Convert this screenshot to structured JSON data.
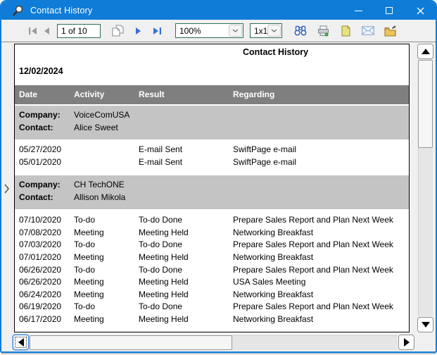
{
  "window": {
    "title": "Contact History"
  },
  "toolbar": {
    "page_value": "1 of 10",
    "zoom_value": "100%",
    "grid_value": "1x1",
    "icons": [
      "first-page",
      "previous-page",
      "copy-pages",
      "next-page",
      "last-page",
      "search-binoculars",
      "print",
      "page-setup",
      "email",
      "export-folder"
    ]
  },
  "report": {
    "title": "Contact History",
    "date": "12/02/2024",
    "columns": [
      "Date",
      "Activity",
      "Result",
      "Regarding"
    ],
    "groups": [
      {
        "company_label": "Company:",
        "company": "VoiceComUSA",
        "contact_label": "Contact:",
        "contact": "Alice Sweet",
        "rows": [
          {
            "date": "05/27/2020",
            "activity": "",
            "result": "E-mail Sent",
            "regarding": "SwiftPage e-mail"
          },
          {
            "date": "05/01/2020",
            "activity": "",
            "result": "E-mail Sent",
            "regarding": "SwiftPage e-mail"
          }
        ]
      },
      {
        "company_label": "Company:",
        "company": "CH TechONE",
        "contact_label": "Contact:",
        "contact": "Allison Mikola",
        "rows": [
          {
            "date": "07/10/2020",
            "activity": "To-do",
            "result": "To-do Done",
            "regarding": "Prepare Sales Report and Plan Next Week"
          },
          {
            "date": "07/08/2020",
            "activity": "Meeting",
            "result": "Meeting Held",
            "regarding": "Networking Breakfast"
          },
          {
            "date": "07/03/2020",
            "activity": "To-do",
            "result": "To-do Done",
            "regarding": "Prepare Sales Report and Plan Next Week"
          },
          {
            "date": "07/01/2020",
            "activity": "Meeting",
            "result": "Meeting Held",
            "regarding": "Networking Breakfast"
          },
          {
            "date": "06/26/2020",
            "activity": "To-do",
            "result": "To-do Done",
            "regarding": "Prepare Sales Report and Plan Next Week"
          },
          {
            "date": "06/26/2020",
            "activity": "Meeting",
            "result": "Meeting Held",
            "regarding": "USA Sales Meeting"
          },
          {
            "date": "06/24/2020",
            "activity": "Meeting",
            "result": "Meeting Held",
            "regarding": "Networking Breakfast"
          },
          {
            "date": "06/19/2020",
            "activity": "To-do",
            "result": "To-do Done",
            "regarding": "Prepare Sales Report and Plan Next Week"
          },
          {
            "date": "06/17/2020",
            "activity": "Meeting",
            "result": "Meeting Held",
            "regarding": "Networking Breakfast"
          }
        ]
      }
    ]
  },
  "colors": {
    "titlebar": "#0f7cd8",
    "column_header_bar": "#7f7f7f",
    "group_band": "#c4c4c4",
    "combo_border": "#2e6b60",
    "page_border": "#000000",
    "nav_enabled": "#3a6fd8",
    "nav_disabled": "#9b9b9b"
  }
}
